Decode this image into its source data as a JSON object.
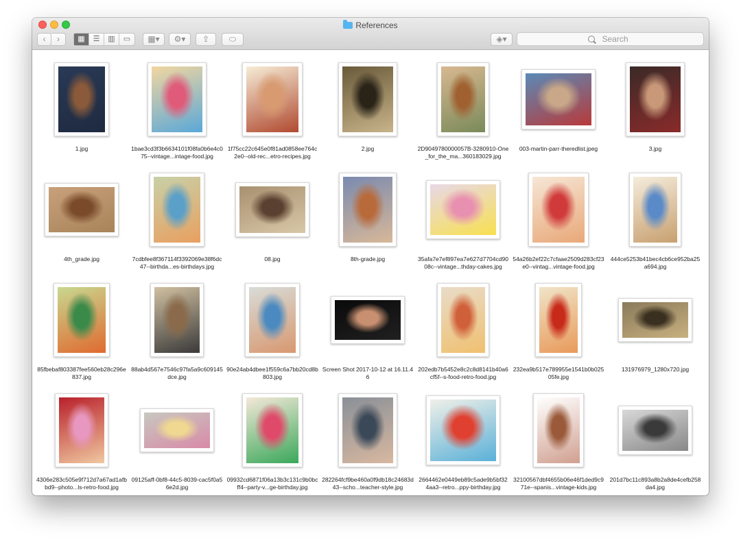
{
  "window": {
    "title": "References"
  },
  "toolbar": {
    "search_placeholder": "Search",
    "back_glyph": "‹",
    "forward_glyph": "›",
    "view_icons": [
      "icon-view-icon",
      "list-view-icon",
      "column-view-icon",
      "coverflow-view-icon"
    ],
    "arrange_glyph": "▦▾",
    "action_glyph": "⚙▾",
    "share_glyph": "⇪",
    "tag_glyph": "⬭",
    "dropbox_glyph": "◈▾"
  },
  "files": [
    {
      "name": "1.jpg",
      "w": 80,
      "h": 108,
      "colors": [
        "#2a3a55",
        "#8a5a3a",
        "#1e2a40"
      ]
    },
    {
      "name": "1bae3cd3f3b6634101f08fa0b6e4c075--vintage...intage-food.jpg",
      "w": 86,
      "h": 108,
      "colors": [
        "#f2d6a0",
        "#e05a7a",
        "#5aa8d8"
      ]
    },
    {
      "name": "1f75cc22c645e0f81ad0858ee764c2e0--old-rec...etro-recipes.jpg",
      "w": 88,
      "h": 108,
      "colors": [
        "#f6ecd6",
        "#d89a70",
        "#b04a30"
      ]
    },
    {
      "name": "2.jpg",
      "w": 86,
      "h": 108,
      "colors": [
        "#6a5a3a",
        "#2a2418",
        "#c8b48a"
      ]
    },
    {
      "name": "2D9049780000057B-3280910-One_for_the_ma...360183029.jpg",
      "w": 76,
      "h": 108,
      "colors": [
        "#d8b890",
        "#a06030",
        "#7a8a5a"
      ]
    },
    {
      "name": "003-martin-parr-theredlist.jpeg",
      "w": 108,
      "h": 88,
      "colors": [
        "#5a8ab8",
        "#c8a888",
        "#b83a3a"
      ]
    },
    {
      "name": "3.jpg",
      "w": 86,
      "h": 108,
      "colors": [
        "#3a2a28",
        "#c89878",
        "#8a2a2a"
      ]
    },
    {
      "name": "4th_grade.jpg",
      "w": 108,
      "h": 78,
      "colors": [
        "#c8a07a",
        "#7a4a2a",
        "#a8845a"
      ]
    },
    {
      "name": "7cdbfee8f367114f3392069e38f6dc47--birthda...es-birthdays.jpg",
      "w": 80,
      "h": 108,
      "colors": [
        "#c8d0a8",
        "#5aa0c8",
        "#e8a060"
      ]
    },
    {
      "name": "08.jpg",
      "w": 108,
      "h": 80,
      "colors": [
        "#a89070",
        "#5a4030",
        "#d8c8a8"
      ]
    },
    {
      "name": "8th-grade.jpg",
      "w": 84,
      "h": 108,
      "colors": [
        "#7a8ab0",
        "#b86a3a",
        "#d8b898"
      ]
    },
    {
      "name": "35afa7e7ef897ea7e627d7704cd9008c--vintage...thday-cakes.jpg",
      "w": 108,
      "h": 86,
      "colors": [
        "#e8d8e8",
        "#e890b0",
        "#f8e050"
      ]
    },
    {
      "name": "54a26b2ef22c7cfaae2509d283cf23e0--vintag...vintage-food.jpg",
      "w": 88,
      "h": 108,
      "colors": [
        "#f6e6d6",
        "#d03a3a",
        "#e8a878"
      ]
    },
    {
      "name": "444ce5253b41bec4cb6ce952ba25a694.jpg",
      "w": 76,
      "h": 108,
      "colors": [
        "#f4ecdc",
        "#5a8ac8",
        "#c8a070"
      ]
    },
    {
      "name": "85fbebaf803387fee560eb28c296e837.jpg",
      "w": 82,
      "h": 108,
      "colors": [
        "#c8d890",
        "#3a8a4a",
        "#e06a30"
      ]
    },
    {
      "name": "88ab4d567e7546c97fa5a9c609145dce.jpg",
      "w": 78,
      "h": 108,
      "colors": [
        "#d0c0a0",
        "#8a6a4a",
        "#3a3a3a"
      ]
    },
    {
      "name": "90e24ab4dbee1f559c6a7bb20cd8b803.jpg",
      "w": 80,
      "h": 108,
      "colors": [
        "#d8dcd8",
        "#4a8ac0",
        "#d89870"
      ]
    },
    {
      "name": "Screen Shot 2017-10-12 at 16.11.46",
      "w": 108,
      "h": 70,
      "colors": [
        "#0a0a0a",
        "#c89070",
        "#202020"
      ]
    },
    {
      "name": "202edb7b5452e8c2c8d8141b40a6cf5f--s-food-retro-food.jpg",
      "w": 76,
      "h": 108,
      "colors": [
        "#e8dcc8",
        "#d0603a",
        "#f0c070"
      ]
    },
    {
      "name": "232ea9b517e789955e1541b0b02505fe.jpg",
      "w": 68,
      "h": 108,
      "colors": [
        "#f0e4c8",
        "#c82a1a",
        "#e89a5a"
      ]
    },
    {
      "name": "131976979_1280x720.jpg",
      "w": 108,
      "h": 64,
      "colors": [
        "#8a7a5a",
        "#3a3020",
        "#c8b080"
      ]
    },
    {
      "name": "4306e283c505e9f712d7a67ad1afbbd9--photo...ls-retro-food.jpg",
      "w": 78,
      "h": 108,
      "colors": [
        "#b8202a",
        "#e898c0",
        "#f0c8a0"
      ]
    },
    {
      "name": "09125aff-0bf8-44c5-8039-cac5f0a56e2d.jpg",
      "w": 108,
      "h": 64,
      "colors": [
        "#c8c8c0",
        "#f0d890",
        "#d88aa8"
      ]
    },
    {
      "name": "09932cd6871f06a13b3c131c9b0bcff4--party-v...ge-birthday.jpg",
      "w": 88,
      "h": 108,
      "colors": [
        "#f4e8d8",
        "#e04a6a",
        "#3aa85a"
      ]
    },
    {
      "name": "282264fcf9be460a0f9db18c24683d43--scho...teacher-style.jpg",
      "w": 86,
      "h": 108,
      "colors": [
        "#8a9098",
        "#3a4858",
        "#d8b8a0"
      ]
    },
    {
      "name": "2664462e0449eb89c5ade9b5bf324aa3--retro...ppy-birthday.jpg",
      "w": 108,
      "h": 102,
      "colors": [
        "#f0f0e8",
        "#e04030",
        "#5ab0d8"
      ]
    },
    {
      "name": "32100567dbf4655b06e46f1ded9c971e--spanis...vintage-kids.jpg",
      "w": 74,
      "h": 108,
      "colors": [
        "#ffffff",
        "#9a5a3a",
        "#d0a090"
      ]
    },
    {
      "name": "201d7bc11c893a8b2a8de4cefb258da4.jpg",
      "w": 108,
      "h": 72,
      "colors": [
        "#d8d8d8",
        "#3a3a3a",
        "#888888"
      ]
    }
  ]
}
